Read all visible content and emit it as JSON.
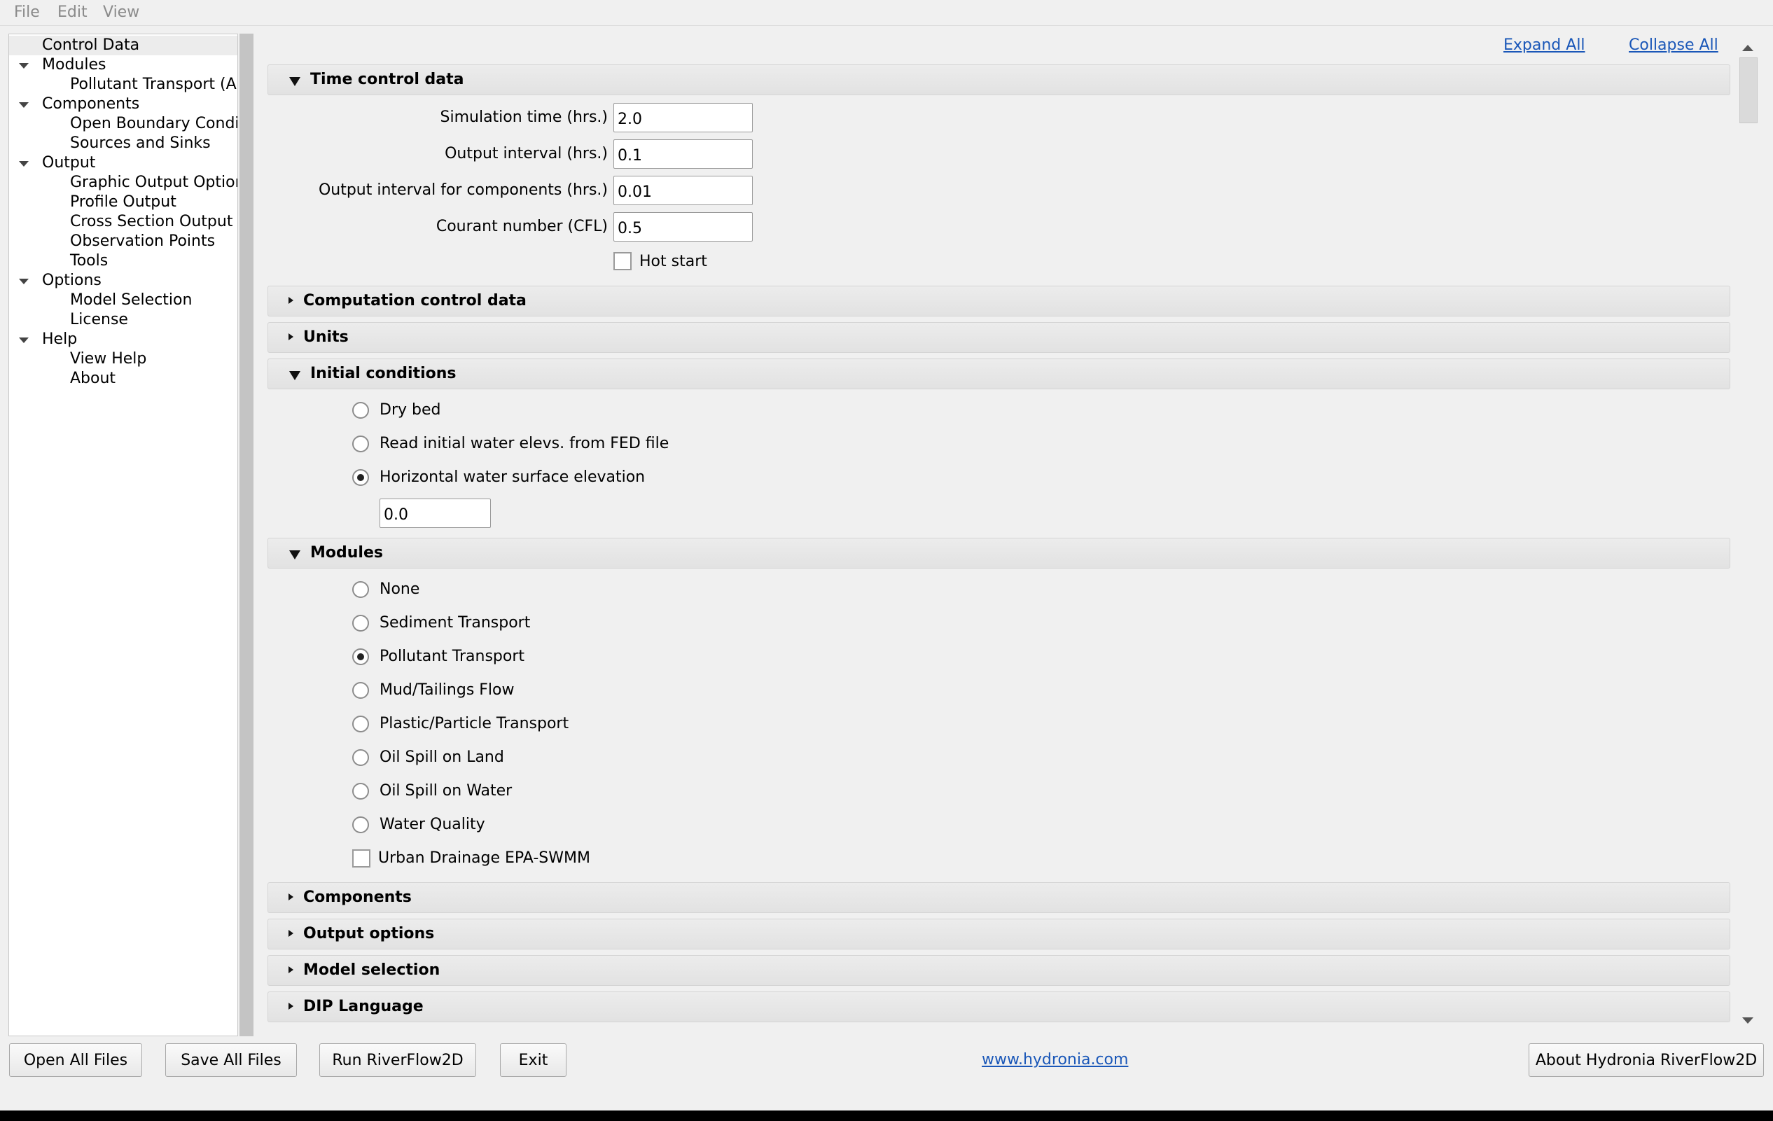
{
  "menu": {
    "file": "File",
    "edit": "Edit",
    "view": "View"
  },
  "tree": {
    "control_data": "Control Data",
    "modules": "Modules",
    "pollutant_transport": "Pollutant Transport (A...",
    "components": "Components",
    "open_boundary": "Open Boundary Condi...",
    "sources_sinks": "Sources and Sinks",
    "output": "Output",
    "graphic_output": "Graphic Output Options",
    "profile_output": "Profile Output",
    "cross_section_output": "Cross Section Output",
    "observation_points": "Observation Points",
    "tools": "Tools",
    "options": "Options",
    "model_selection": "Model Selection",
    "license": "License",
    "help": "Help",
    "view_help": "View Help",
    "about": "About"
  },
  "links": {
    "expand_all": "Expand All",
    "collapse_all": "Collapse All",
    "website": "www.hydronia.com"
  },
  "time_control": {
    "title": "Time control data",
    "simulation_time_label": "Simulation time (hrs.)",
    "simulation_time": "2.0",
    "output_interval_label": "Output interval (hrs.)",
    "output_interval": "0.1",
    "output_interval_components_label": "Output interval for components (hrs.)",
    "output_interval_components": "0.01",
    "courant_label": "Courant number (CFL)",
    "courant": "0.5",
    "hot_start_label": "Hot start",
    "hot_start_checked": false
  },
  "computation_control": {
    "title": "Computation control data"
  },
  "units": {
    "title": "Units"
  },
  "initial_conditions": {
    "title": "Initial conditions",
    "dry_bed": "Dry bed",
    "read_fed": "Read initial water elevs. from FED file",
    "horizontal": "Horizontal water surface elevation",
    "selected": "horizontal",
    "elevation_value": "0.0"
  },
  "modules": {
    "title": "Modules",
    "options": [
      "None",
      "Sediment Transport",
      "Pollutant Transport",
      "Mud/Tailings Flow",
      "Plastic/Particle Transport",
      "Oil Spill on Land",
      "Oil Spill on Water",
      "Water Quality"
    ],
    "selected": "Pollutant Transport",
    "urban_drainage_label": "Urban Drainage EPA-SWMM",
    "urban_drainage_checked": false
  },
  "components_section": {
    "title": "Components"
  },
  "output_options": {
    "title": "Output options"
  },
  "model_selection_section": {
    "title": "Model selection"
  },
  "dip_language": {
    "title": "DIP Language"
  },
  "buttons": {
    "open_all": "Open All Files",
    "save_all": "Save All Files",
    "run": "Run RiverFlow2D",
    "exit": "Exit",
    "about": "About Hydronia RiverFlow2D"
  }
}
